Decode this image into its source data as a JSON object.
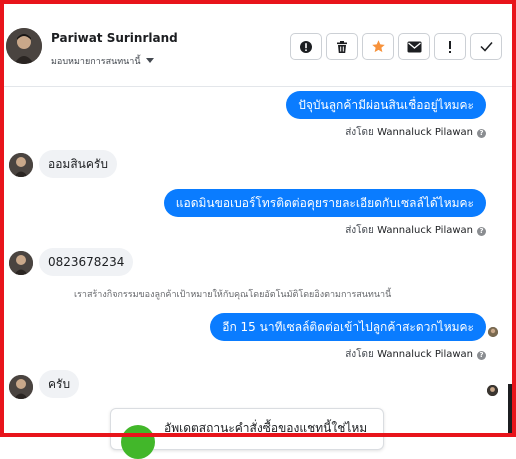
{
  "header": {
    "contact_name": "Pariwat Surinrland",
    "assign_label": "มอบหมายการสนทนานี้"
  },
  "toolbar": [
    {
      "name": "spam-button",
      "icon": "alert-circle-icon"
    },
    {
      "name": "delete-button",
      "icon": "trash-icon"
    },
    {
      "name": "star-button",
      "icon": "star-icon",
      "color": "#f7923b"
    },
    {
      "name": "mark-unread-button",
      "icon": "envelope-icon"
    },
    {
      "name": "follow-up-button",
      "icon": "exclamation-icon"
    },
    {
      "name": "done-button",
      "icon": "checkmark-icon"
    }
  ],
  "colors": {
    "frame": "#e8141b",
    "bubble_out": "#0a7cff",
    "bubble_in": "#f0f2f5",
    "card_icon": "#42b72a"
  },
  "messages": [
    {
      "direction": "out",
      "text": "ปัจุบันลูกค้ามีผ่อนสินเชื่ออยู่ไหมคะ"
    },
    {
      "direction": "in",
      "text": "ออมสินครับ"
    },
    {
      "direction": "out",
      "text": "แอดมินขอเบอร์โทรติดต่อคุยรายละเอียดกับเซลล์ได้ไหมคะ"
    },
    {
      "direction": "in",
      "text": "0823678234"
    },
    {
      "direction": "out",
      "text": "อีก 15 นาทีเซลล์ติดต่อเข้าไปลูกค้าสะดวกไหมคะ"
    },
    {
      "direction": "in",
      "text": "ครับ"
    }
  ],
  "sent_by": {
    "prefix": "ส่งโดย",
    "agent": "Wannaluck Pilawan",
    "help": "?"
  },
  "system_message": "เราสร้างกิจกรรมของลูกค้าเป้าหมายให้กับคุณโดยอัตโนมัติโดยอิงตามการสนทนานี้",
  "card": {
    "text": "อัพเดตสถานะคำสั่งซื้อของแชทนี้ใช่ไหม"
  }
}
